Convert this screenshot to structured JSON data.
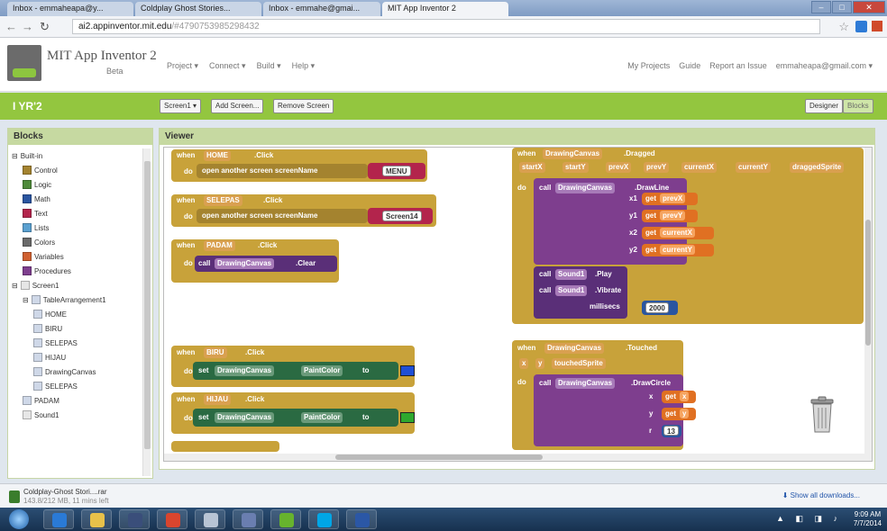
{
  "browser": {
    "tabs": [
      {
        "label": "Inbox - emmaheapa@y..."
      },
      {
        "label": "Coldplay Ghost Stories..."
      },
      {
        "label": "Inbox - emmahe@gmai..."
      },
      {
        "label": "MIT App Inventor 2"
      }
    ],
    "url_host": "ai2.appinventor.mit.edu",
    "url_path": "/#4790753985298432",
    "window_controls": [
      "–",
      "□",
      "✕"
    ]
  },
  "app": {
    "title": "MIT App Inventor 2",
    "beta": "Beta",
    "menu": [
      "Project ▾",
      "Connect ▾",
      "Build ▾",
      "Help ▾"
    ],
    "top_right": [
      "My Projects",
      "Guide",
      "Report an Issue",
      "emmaheapa@gmail.com ▾"
    ]
  },
  "project": {
    "name": "I YR'2",
    "screen_select": "Screen1 ▾",
    "add_screen": "Add Screen...",
    "remove_screen": "Remove Screen",
    "designer": "Designer",
    "blocks": "Blocks"
  },
  "blocks_panel": {
    "title": "Blocks",
    "items": [
      {
        "label": "Built-in",
        "indent": 0,
        "expander": "⊟",
        "color": ""
      },
      {
        "label": "Control",
        "indent": 1,
        "color": "#a4832f"
      },
      {
        "label": "Logic",
        "indent": 1,
        "color": "#4e8a3a"
      },
      {
        "label": "Math",
        "indent": 1,
        "color": "#2a55a0"
      },
      {
        "label": "Text",
        "indent": 1,
        "color": "#b3244c"
      },
      {
        "label": "Lists",
        "indent": 1,
        "color": "#5aa0d0"
      },
      {
        "label": "Colors",
        "indent": 1,
        "color": "#6a6a6a"
      },
      {
        "label": "Variables",
        "indent": 1,
        "color": "#d06030"
      },
      {
        "label": "Procedures",
        "indent": 1,
        "color": "#7e3e8e"
      },
      {
        "label": "Screen1",
        "indent": 0,
        "expander": "⊟",
        "color": "#e6e6e6"
      },
      {
        "label": "TableArrangement1",
        "indent": 1,
        "expander": "⊟",
        "color": "#cfd8e8"
      },
      {
        "label": "HOME",
        "indent": 2,
        "color": "#cfd8e8"
      },
      {
        "label": "BIRU",
        "indent": 2,
        "color": "#cfd8e8"
      },
      {
        "label": "SELEPAS",
        "indent": 2,
        "color": "#cfd8e8"
      },
      {
        "label": "HIJAU",
        "indent": 2,
        "color": "#cfd8e8"
      },
      {
        "label": "DrawingCanvas",
        "indent": 2,
        "color": "#cfd8e8"
      },
      {
        "label": "SELEPAS",
        "indent": 2,
        "color": "#cfd8e8"
      },
      {
        "label": "PADAM",
        "indent": 1,
        "color": "#cfd8e8"
      },
      {
        "label": "Sound1",
        "indent": 1,
        "color": "#e6e6e6"
      }
    ]
  },
  "viewer": {
    "title": "Viewer",
    "blocks": {
      "home": {
        "when": "when",
        "component": "HOME",
        "event": ".Click",
        "do": "do",
        "action": "open another screen  screenName",
        "value": "MENU"
      },
      "selepas": {
        "when": "when",
        "component": "SELEPAS",
        "event": ".Click",
        "do": "do",
        "action": "open another screen  screenName",
        "value": "Screen14"
      },
      "padam": {
        "when": "when",
        "component": "PADAM",
        "event": ".Click",
        "do": "do",
        "call": "call",
        "target": "DrawingCanvas",
        "method": ".Clear"
      },
      "biru": {
        "when": "when",
        "component": "BIRU",
        "event": ".Click",
        "do": "do",
        "set": "set",
        "target": "DrawingCanvas",
        "prop": "PaintColor",
        "to": "to",
        "swatch": "#1f4fd6"
      },
      "hijau": {
        "when": "when",
        "component": "HIJAU",
        "event": ".Click",
        "do": "do",
        "set": "set",
        "target": "DrawingCanvas",
        "prop": "PaintColor",
        "to": "to",
        "swatch": "#2ea82e"
      },
      "dragged": {
        "when": "when",
        "component": "DrawingCanvas",
        "event": ".Dragged",
        "params": [
          "startX",
          "startY",
          "prevX",
          "prevY",
          "currentX",
          "currentY",
          "draggedSprite"
        ],
        "do": "do",
        "call": "call",
        "target": "DrawingCanvas",
        "method": ".DrawLine",
        "args": [
          {
            "name": "x1",
            "get": "get",
            "value": "prevX"
          },
          {
            "name": "y1",
            "get": "get",
            "value": "prevY"
          },
          {
            "name": "x2",
            "get": "get",
            "value": "currentX"
          },
          {
            "name": "y2",
            "get": "get",
            "value": "currentY"
          }
        ],
        "play_target": "Sound1",
        "play_method": ".Play",
        "vibrate_target": "Sound1",
        "vibrate_method": ".Vibrate",
        "millisecs": "millisecs",
        "millisecs_value": "2000"
      },
      "touched": {
        "when": "when",
        "component": "DrawingCanvas",
        "event": ".Touched",
        "params": [
          "x",
          "y",
          "touchedSprite"
        ],
        "do": "do",
        "call": "call",
        "target": "DrawingCanvas",
        "method": ".DrawCircle",
        "args": [
          {
            "name": "x",
            "get": "get",
            "value": "x"
          },
          {
            "name": "y",
            "get": "get",
            "value": "y"
          },
          {
            "name": "r",
            "value": "13"
          }
        ]
      }
    }
  },
  "downloads": {
    "file": "Coldplay-Ghost Stori....rar",
    "size": "143.8/212 MB, 11 mins left",
    "show_all": "⬇ Show all downloads..."
  },
  "taskbar": {
    "clock_time": "9:09 AM",
    "clock_date": "7/7/2014",
    "apps": [
      {
        "name": "ie-icon",
        "color": "#2a7ad6"
      },
      {
        "name": "explorer-icon",
        "color": "#e8c14a"
      },
      {
        "name": "media-player-icon",
        "color": "#3a4e7a"
      },
      {
        "name": "chrome-icon",
        "color": "#d9452e"
      },
      {
        "name": "camera-icon",
        "color": "#b8c4d4"
      },
      {
        "name": "sticky-icon",
        "color": "#6a7eb0"
      },
      {
        "name": "spotify-icon",
        "color": "#67b32d"
      },
      {
        "name": "skype-icon",
        "color": "#00a6e6"
      },
      {
        "name": "word-icon",
        "color": "#2b57a6"
      }
    ]
  }
}
